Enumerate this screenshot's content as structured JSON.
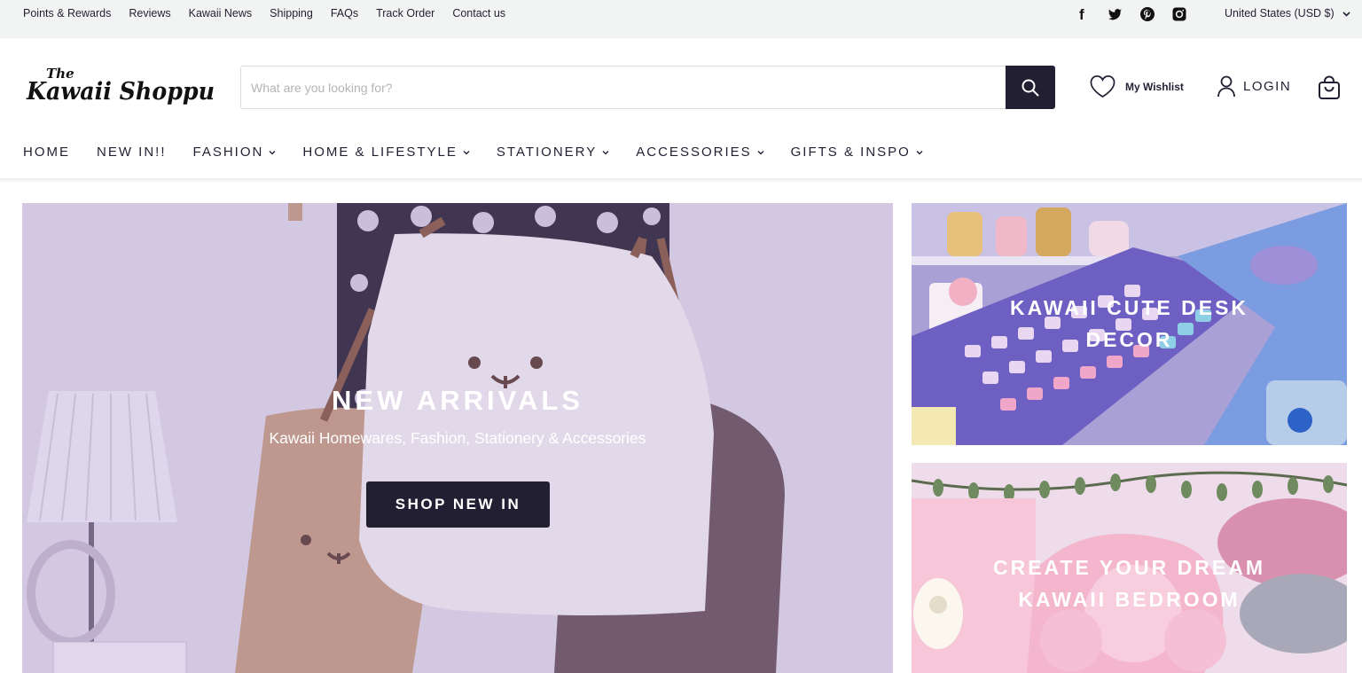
{
  "topbar": {
    "links": [
      "Points & Rewards",
      "Reviews",
      "Kawaii News",
      "Shipping",
      "FAQs",
      "Track Order",
      "Contact us"
    ],
    "socials": [
      "facebook-icon",
      "twitter-icon",
      "pinterest-icon",
      "instagram-icon"
    ],
    "currency": "United States (USD $)"
  },
  "header": {
    "logo_small": "The",
    "logo_main": "Kawaii Shoppu",
    "search_placeholder": "What are you looking for?",
    "wishlist_label": "My Wishlist",
    "login_label": "LOGIN"
  },
  "nav": {
    "items": [
      {
        "label": "HOME",
        "dropdown": false
      },
      {
        "label": "NEW IN!!",
        "dropdown": false
      },
      {
        "label": "FASHION",
        "dropdown": true
      },
      {
        "label": "HOME & LIFESTYLE",
        "dropdown": true
      },
      {
        "label": "STATIONERY",
        "dropdown": true
      },
      {
        "label": "ACCESSORIES",
        "dropdown": true
      },
      {
        "label": "GIFTS & INSPO",
        "dropdown": true
      }
    ]
  },
  "hero": {
    "title": "NEW ARRIVALS",
    "subtitle": "Kawaii Homewares, Fashion, Stationery & Accessories",
    "button": "SHOP NEW IN"
  },
  "tiles": [
    {
      "line1": "KAWAII CUTE DESK",
      "line2": "DECOR"
    },
    {
      "line1": "CREATE YOUR DREAM",
      "line2": "KAWAII BEDROOM"
    }
  ],
  "colors": {
    "brand_dark": "#231f33",
    "topbar_bg": "#f2f3f3"
  }
}
